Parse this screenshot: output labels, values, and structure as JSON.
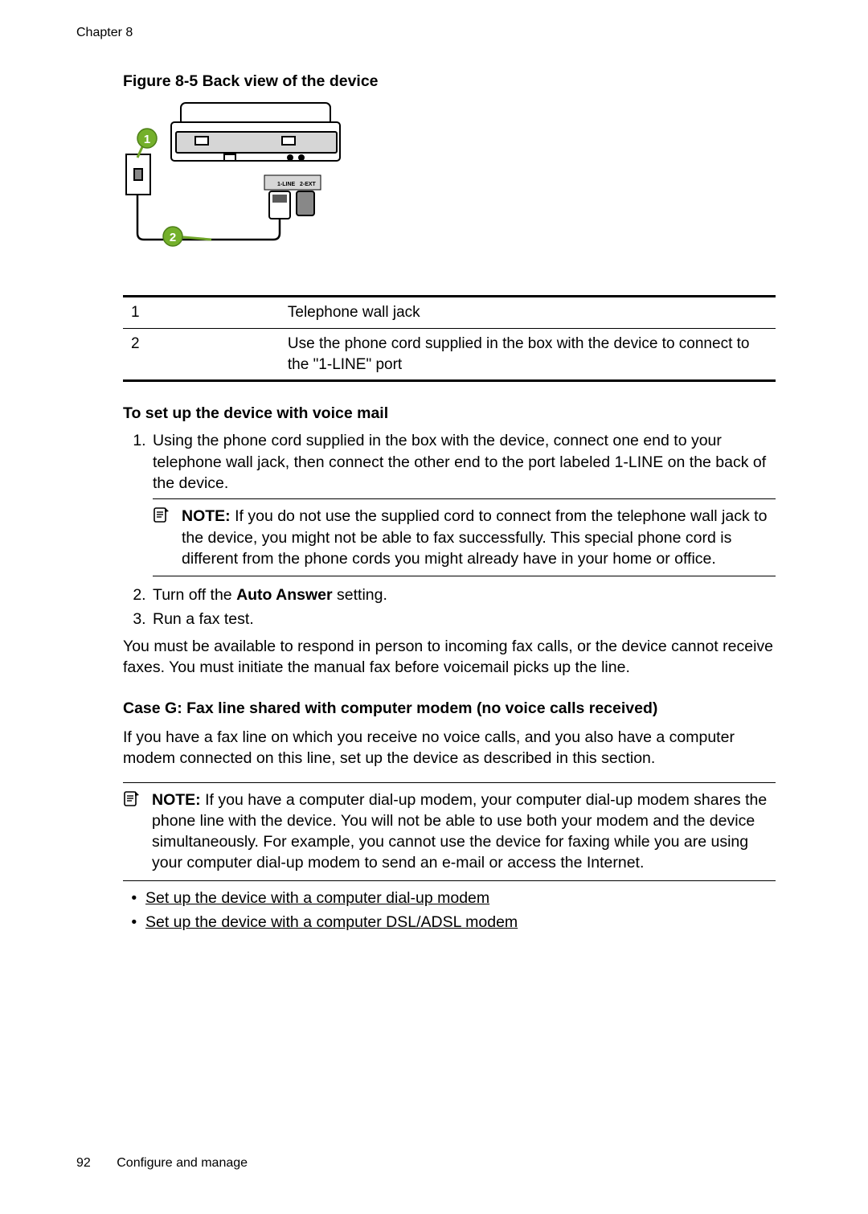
{
  "header": {
    "chapter": "Chapter 8"
  },
  "figure": {
    "caption": "Figure 8-5  Back view of the device",
    "port_label_left": "1-LINE",
    "port_label_right": "2-EXT",
    "callout1": "1",
    "callout2": "2"
  },
  "legend": {
    "r1c1": "1",
    "r1c2": "Telephone wall jack",
    "r2c1": "2",
    "r2c2": "Use the phone cord supplied in the box with the device to connect to the \"1-LINE\" port"
  },
  "setup": {
    "title": "To set up the device with voice mail",
    "step1": "Using the phone cord supplied in the box with the device, connect one end to your telephone wall jack, then connect the other end to the port labeled 1-LINE on the back of the device.",
    "note1_prefix": "NOTE:",
    "note1_body": "  If you do not use the supplied cord to connect from the telephone wall jack to the device, you might not be able to fax successfully. This special phone cord is different from the phone cords you might already have in your home or office.",
    "step2_pre": "Turn off the ",
    "step2_bold": "Auto Answer",
    "step2_post": " setting.",
    "step3": "Run a fax test.",
    "must_para": "You must be available to respond in person to incoming fax calls, or the device cannot receive faxes. You must initiate the manual fax before voicemail picks up the line."
  },
  "caseg": {
    "heading": "Case G: Fax line shared with computer modem (no voice calls received)",
    "intro": "If you have a fax line on which you receive no voice calls, and you also have a computer modem connected on this line, set up the device as described in this section.",
    "note_prefix": "NOTE:",
    "note_body": "  If you have a computer dial-up modem, your computer dial-up modem shares the phone line with the device. You will not be able to use both your modem and the device simultaneously. For example, you cannot use the device for faxing while you are using your computer dial-up modem to send an e-mail or access the Internet.",
    "link1": "Set up the device with a computer dial-up modem",
    "link2": "Set up the device with a computer DSL/ADSL modem"
  },
  "footer": {
    "page_number": "92",
    "section": "Configure and manage"
  }
}
